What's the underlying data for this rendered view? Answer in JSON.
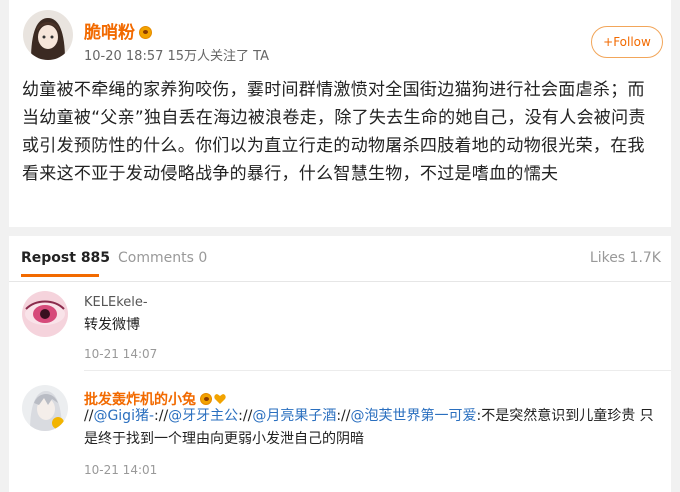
{
  "post": {
    "author": "脆哨粉",
    "meta": "10-20 18:57  15万人关注了 TA",
    "follow_label": "+Follow",
    "text": "幼童被不牵绳的家养狗咬伤，霎时间群情激愤对全国街边猫狗进行社会面虐杀；而当幼童被“父亲”独自丢在海边被浪卷走，除了失去生命的她自己，没有人会被问责或引发预防性的什么。你们以为直立行走的动物屠杀四肢着地的动物很光荣，在我看来这不亚于发动侵略战争的暴行，什么智慧生物，不过是嗜血的懦夫"
  },
  "tabs": {
    "repost": "Repost 885",
    "comments": "Comments 0",
    "likes": "Likes 1.7K"
  },
  "reposts": [
    {
      "name": "KELEkele-",
      "text": "转发微博",
      "time": "10-21 14:07"
    },
    {
      "name": "批发轰炸机的小兔",
      "text_parts": [
        "//",
        "@Gigi猪-",
        ":",
        "//",
        "@牙牙主公",
        ":",
        "//",
        "@月亮果子酒",
        ":",
        "//",
        "@泡芙世界第一可爱",
        ":不是突然意识到儿童珍贵 只是终于找到一个理由向更弱小发泄自己的阴暗"
      ],
      "time": "10-21 14:01"
    }
  ],
  "colors": {
    "accent": "#f26a00",
    "link": "#2a6fbf"
  }
}
